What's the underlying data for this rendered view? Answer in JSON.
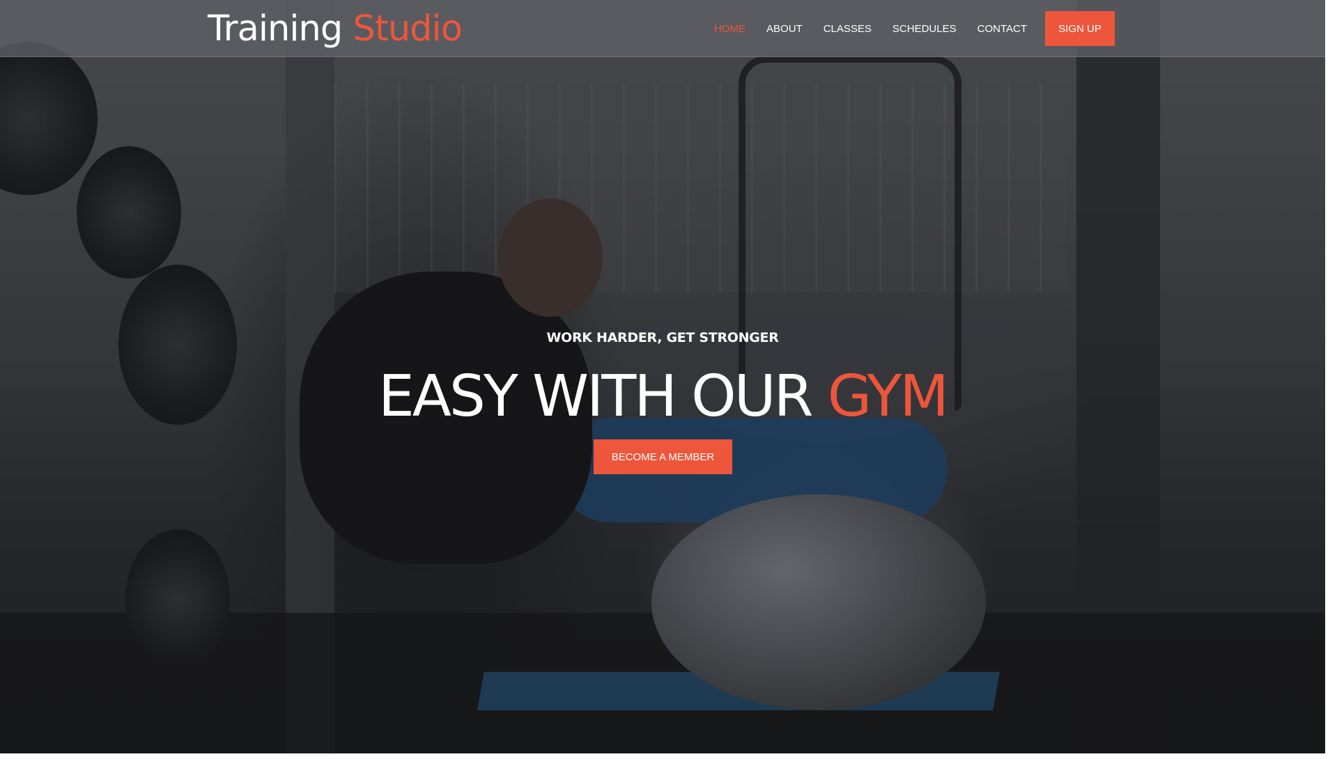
{
  "header": {
    "logo_primary": "Training",
    "logo_accent": "Studio",
    "nav": [
      {
        "label": "HOME"
      },
      {
        "label": "ABOUT"
      },
      {
        "label": "CLASSES"
      },
      {
        "label": "SCHEDULES"
      },
      {
        "label": "CONTACT"
      }
    ],
    "active_nav": "HOME",
    "signup_label": "SIGN UP"
  },
  "hero": {
    "kicker": "WORK HARDER, GET STRONGER",
    "headline_primary": "EASY WITH OUR",
    "headline_accent": "GYM",
    "cta_label": "BECOME A MEMBER",
    "background_image": "gym-trainer-background"
  },
  "colors": {
    "accent": "#ed563b",
    "text": "#ffffff",
    "header_bg": "#5f6266"
  }
}
